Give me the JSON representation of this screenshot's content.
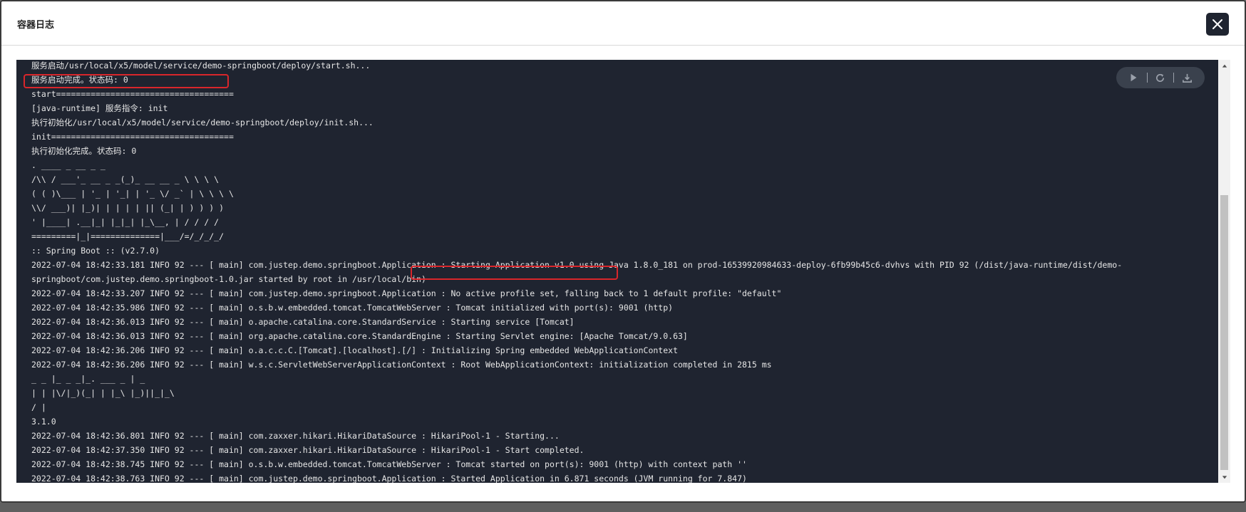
{
  "dialog": {
    "title": "容器日志",
    "close_icon": "close-icon"
  },
  "toolbar": {
    "play_icon": "play-icon",
    "refresh_icon": "refresh-icon",
    "download_icon": "download-icon"
  },
  "colors": {
    "log_background": "#1f2430",
    "log_text": "#e6e6e6",
    "highlight": "#d9262b",
    "close_button": "#1f2430"
  },
  "log": {
    "lines": [
      "服务启动/usr/local/x5/model/service/demo-springboot/deploy/start.sh...",
      "服务启动完成。状态码: 0",
      "start====================================",
      "[java-runtime] 服务指令: init",
      "执行初始化/usr/local/x5/model/service/demo-springboot/deploy/init.sh...",
      "init=====================================",
      "执行初始化完成。状态码: 0",
      ". ____ _ __ _ _",
      "/\\\\ / ___'_ __ _ _(_)_ __ __ _ \\ \\ \\ \\",
      "( ( )\\___ | '_ | '_| | '_ \\/ _` | \\ \\ \\ \\",
      "\\\\/ ___)| |_)| | | | | || (_| | ) ) ) )",
      "' |____| .__|_| |_|_| |_\\__, | / / / /",
      "=========|_|==============|___/=/_/_/_/",
      ":: Spring Boot :: (v2.7.0)",
      "2022-07-04 18:42:33.181 INFO 92 --- [ main] com.justep.demo.springboot.Application : Starting Application v1.0 using Java 1.8.0_181 on prod-16539920984633-deploy-6fb99b45c6-dvhvs with PID 92 (/dist/java-runtime/dist/demo-",
      "springboot/com.justep.demo.springboot-1.0.jar started by root in /usr/local/bin)",
      "2022-07-04 18:42:33.207 INFO 92 --- [ main] com.justep.demo.springboot.Application : No active profile set, falling back to 1 default profile: \"default\"",
      "2022-07-04 18:42:35.986 INFO 92 --- [ main] o.s.b.w.embedded.tomcat.TomcatWebServer : Tomcat initialized with port(s): 9001 (http)",
      "2022-07-04 18:42:36.013 INFO 92 --- [ main] o.apache.catalina.core.StandardService : Starting service [Tomcat]",
      "2022-07-04 18:42:36.013 INFO 92 --- [ main] org.apache.catalina.core.StandardEngine : Starting Servlet engine: [Apache Tomcat/9.0.63]",
      "2022-07-04 18:42:36.206 INFO 92 --- [ main] o.a.c.c.C.[Tomcat].[localhost].[/] : Initializing Spring embedded WebApplicationContext",
      "2022-07-04 18:42:36.206 INFO 92 --- [ main] w.s.c.ServletWebServerApplicationContext : Root WebApplicationContext: initialization completed in 2815 ms",
      "_ _ |_ _ _|_. ___ _ | _",
      "| | |\\/|_)(_| | |_\\ |_)||_|_\\",
      "/ |",
      "3.1.0",
      "2022-07-04 18:42:36.801 INFO 92 --- [ main] com.zaxxer.hikari.HikariDataSource : HikariPool-1 - Starting...",
      "2022-07-04 18:42:37.350 INFO 92 --- [ main] com.zaxxer.hikari.HikariDataSource : HikariPool-1 - Start completed.",
      "2022-07-04 18:42:38.745 INFO 92 --- [ main] o.s.b.w.embedded.tomcat.TomcatWebServer : Tomcat started on port(s): 9001 (http) with context path ''",
      "2022-07-04 18:42:38.763 INFO 92 --- [ main] com.justep.demo.springboot.Application : Started Application in 6.871 seconds (JVM running for 7.847)"
    ]
  }
}
